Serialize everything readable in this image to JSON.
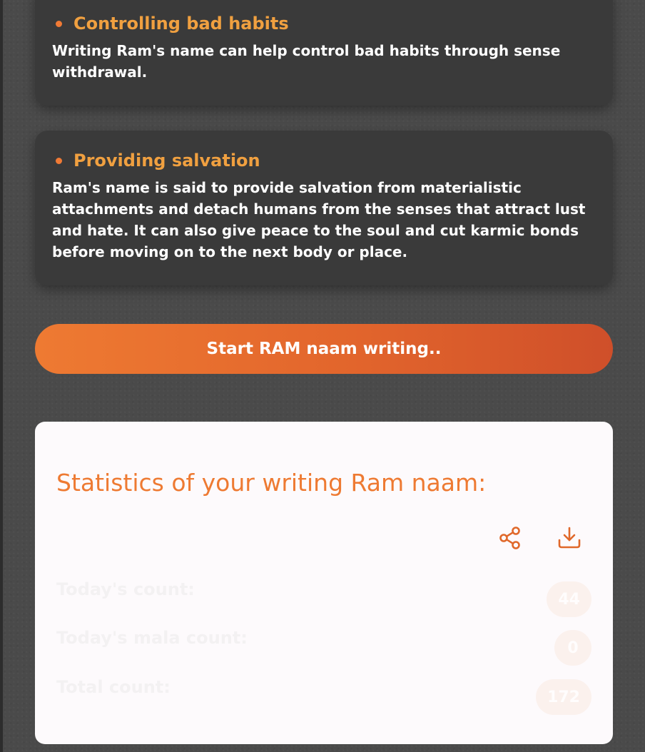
{
  "benefits": [
    {
      "title": "Controlling bad habits",
      "text": "Writing Ram's name can help control bad habits through sense withdrawal."
    },
    {
      "title": "Providing salvation",
      "text": "Ram's name is said to provide salvation from materialistic attachments and detach humans from the senses that attract lust and hate. It can also give peace to the soul and cut karmic bonds before moving on to the next body or place."
    }
  ],
  "start_button": {
    "label": "Start RAM naam writing.."
  },
  "stats": {
    "title": "Statistics of your writing Ram naam:",
    "share_icon": "share-icon",
    "download_icon": "download-icon",
    "rows": [
      {
        "label": "Today's count:",
        "value": "44"
      },
      {
        "label": "Today's mala count:",
        "value": "0"
      },
      {
        "label": "Total count:",
        "value": "172"
      }
    ]
  },
  "colors": {
    "accent": "#ee7a32",
    "heading": "#f0a040",
    "card": "#3a3a3a",
    "background": "#4a4a4a"
  }
}
